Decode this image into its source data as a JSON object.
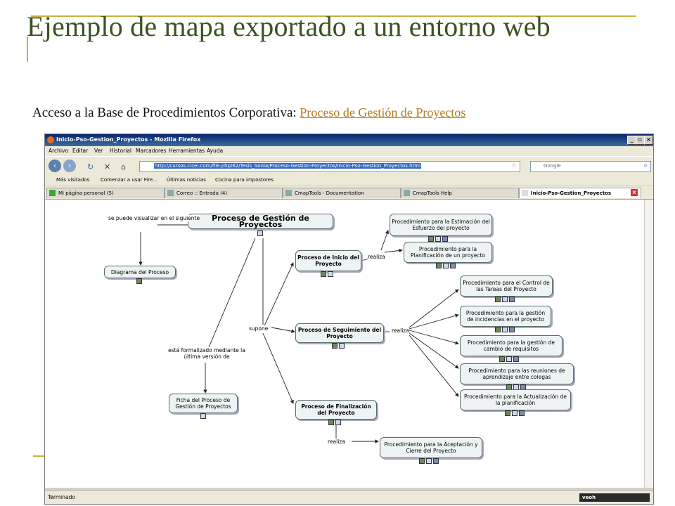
{
  "slide": {
    "title": "Ejemplo de mapa exportado a un entorno web",
    "intro_text": "Acceso a la Base de Procedimientos Corporativa:",
    "intro_link": "Proceso de Gestión de Proyectos",
    "accent_color": "#c8b23a",
    "title_color": "#3b5321"
  },
  "browser": {
    "window_title": "Inicio-Pso-Gestion_Proyectos - Mozilla Firefox",
    "menu": [
      "Archivo",
      "Editar",
      "Ver",
      "Historial",
      "Marcadores",
      "Herramientas",
      "Ayuda"
    ],
    "url": "http://cursos.cicei.com/file.php/62/Tesis_Sonia/Proceso-Gestion-Proyectos/Inicio-Pso-Gestion_Proyectos.html",
    "search_placeholder": "Google",
    "bookmarks": [
      "Más visitados",
      "Comenzar a usar Fire...",
      "Últimas noticias",
      "Cocina para impostores"
    ],
    "tabs": [
      "Mi página personal (5)",
      "Correo :: Entrada (4)",
      "CmapTools - Documentation",
      "CmapTools Help",
      "Inicio-Pso-Gestion_Proyectos"
    ],
    "status": "Terminado",
    "status_badge": "veoh"
  },
  "cmap": {
    "nodes": {
      "main": "Proceso de Gestión de Proyectos",
      "diagrama": "Diagrama del Proceso",
      "ficha": "Ficha del Proceso de Gestión de Proyectos",
      "inicio": "Proceso de Inicio del Proyecto",
      "seguimiento": "Proceso de Seguimiento del Proyecto",
      "finalizacion": "Proceso de Finalización del Proyecto",
      "p_estimacion": "Procedimiento para la Estimación del Esfuerzo del proyecto",
      "p_planificacion": "Procedimiento para la Planificación de un proyecto",
      "p_control": "Procedimiento para el Control de las Tareas del Proyecto",
      "p_incidencias": "Procedimiento para la gestión de incidencias en el proyecto",
      "p_cambio": "Procedimiento para la gestión de cambio de requisitos",
      "p_reuniones": "Procedimiento para las reuniones de aprendizaje entre colegas",
      "p_actualizacion": "Procedimiento para la Actualización de la planificación",
      "p_aceptacion": "Procedimiento para la Aceptación y Cierre del Proyecto"
    },
    "links": {
      "visualizar": "se puede visualizar en el siguiente",
      "formalizado": "está formalizado mediante la última versión de",
      "supone": "supone",
      "realiza_1": "realiza",
      "realiza_2": "realiza",
      "realiza_3": "realiza"
    }
  }
}
